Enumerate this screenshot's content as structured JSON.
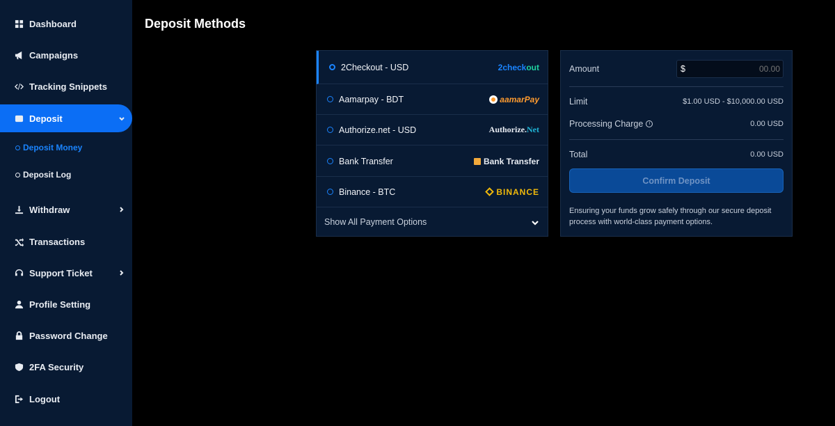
{
  "sidebar": {
    "items": [
      {
        "label": "Dashboard",
        "icon": "dashboard-icon"
      },
      {
        "label": "Campaigns",
        "icon": "megaphone-icon"
      },
      {
        "label": "Tracking Snippets",
        "icon": "code-icon"
      },
      {
        "label": "Deposit",
        "icon": "wallet-icon",
        "active": true
      },
      {
        "label": "Withdraw",
        "icon": "withdraw-icon"
      },
      {
        "label": "Transactions",
        "icon": "shuffle-icon"
      },
      {
        "label": "Support Ticket",
        "icon": "headset-icon"
      },
      {
        "label": "Profile Setting",
        "icon": "user-icon"
      },
      {
        "label": "Password Change",
        "icon": "lock-icon"
      },
      {
        "label": "2FA Security",
        "icon": "shield-icon"
      },
      {
        "label": "Logout",
        "icon": "logout-icon"
      }
    ],
    "deposit_sub": [
      {
        "label": "Deposit Money",
        "active": true
      },
      {
        "label": "Deposit Log"
      }
    ]
  },
  "page": {
    "title": "Deposit Methods"
  },
  "methods": {
    "items": [
      {
        "label": "2Checkout - USD",
        "logo_a": "2check",
        "logo_b": "out"
      },
      {
        "label": "Aamarpay - BDT",
        "logo_a": "aamarPay"
      },
      {
        "label": "Authorize.net - USD",
        "logo_a": "Authorize.",
        "logo_b": "Net"
      },
      {
        "label": "Bank Transfer",
        "logo_a": "Bank Transfer"
      },
      {
        "label": "Binance - BTC",
        "logo_a": "BINANCE"
      }
    ],
    "show_all": "Show All Payment Options"
  },
  "summary": {
    "amount_label": "Amount",
    "currency": "$",
    "amount_placeholder": "00.00",
    "limit_label": "Limit",
    "limit_value": "$1.00 USD - $10,000.00 USD",
    "charge_label": "Processing Charge",
    "charge_value": "0.00 USD",
    "total_label": "Total",
    "total_value": "0.00 USD",
    "confirm_label": "Confirm Deposit",
    "note": "Ensuring your funds grow safely through our secure deposit process with world-class payment options."
  },
  "colors": {
    "sidebar_bg": "#081a33",
    "accent": "#0b6ef5",
    "page_bg": "#000000",
    "panel_bg": "#081a33"
  }
}
